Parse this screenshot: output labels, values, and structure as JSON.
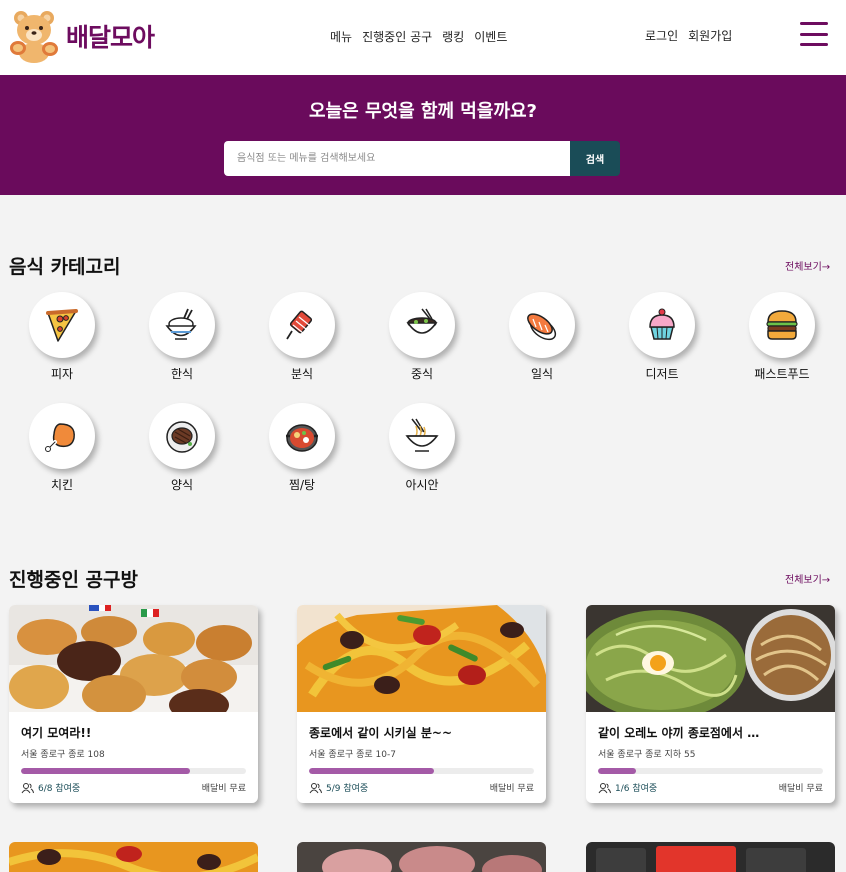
{
  "header": {
    "logo_text": "배달모아",
    "nav": [
      "메뉴",
      "진행중인 공구",
      "랭킹",
      "이벤트"
    ],
    "auth": [
      "로그인",
      "회원가입"
    ]
  },
  "hero": {
    "title": "오늘은 무엇을 함께 먹을까요?",
    "search_placeholder": "음식점 또는 메뉴를 검색해보세요",
    "search_button": "검색"
  },
  "categories_section": {
    "title": "음식 카테고리",
    "see_all": "전체보기→",
    "items": [
      {
        "label": "피자",
        "icon": "pizza-icon"
      },
      {
        "label": "한식",
        "icon": "rice-bowl-icon"
      },
      {
        "label": "분식",
        "icon": "tteokbokki-icon"
      },
      {
        "label": "중식",
        "icon": "noodle-bowl-icon"
      },
      {
        "label": "일식",
        "icon": "sushi-icon"
      },
      {
        "label": "디저트",
        "icon": "cupcake-icon"
      },
      {
        "label": "패스트푸드",
        "icon": "burger-icon"
      },
      {
        "label": "치킨",
        "icon": "chicken-leg-icon"
      },
      {
        "label": "양식",
        "icon": "steak-icon"
      },
      {
        "label": "찜/탕",
        "icon": "hot-pot-icon"
      },
      {
        "label": "아시안",
        "icon": "asian-noodle-icon"
      }
    ]
  },
  "groups_section": {
    "title": "진행중인 공구방",
    "see_all": "전체보기→",
    "cards": [
      {
        "title": "여기 모여라!!",
        "address": "서울 종로구 종로 108",
        "members": "6/8 참여중",
        "progress": 0.75,
        "fee": "배달비 무료",
        "image": "bread-photo"
      },
      {
        "title": "종로에서 같이 시키실 분~~",
        "address": "서울 종로구 종로 10-7",
        "members": "5/9 참여중",
        "progress": 0.556,
        "fee": "배달비 무료",
        "image": "stir-fry-photo"
      },
      {
        "title": "같이 오레노 야끼 종로점에서 …",
        "address": "서울 종로구 종로 지하 55",
        "members": "1/6 참여중",
        "progress": 0.167,
        "fee": "배달비 무료",
        "image": "okonomiyaki-photo"
      }
    ]
  },
  "colors": {
    "brand": "#6a0b5c",
    "search_button": "#1a4c57",
    "progress": "#a45aa7"
  }
}
